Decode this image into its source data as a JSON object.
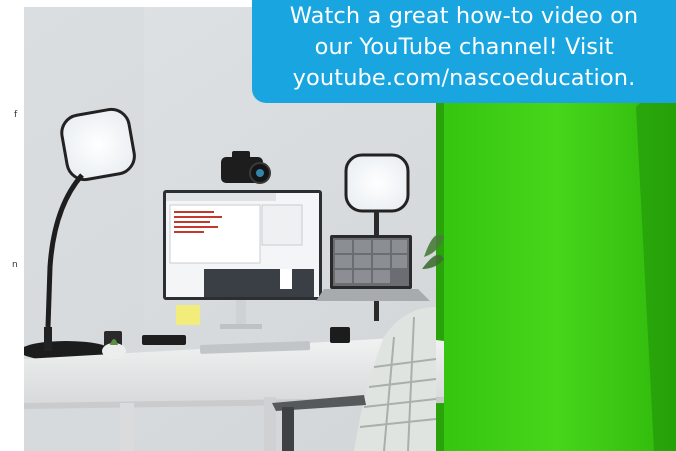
{
  "callout": {
    "line1": "Watch a great how-to video on",
    "line2": "our YouTube channel! Visit",
    "line3": "youtube.com/nascoeducation."
  },
  "photo": {
    "subject": "Desk workstation with ring lights, camera, monitor, laptop and green screen"
  },
  "margin_fragments": {
    "top": "f",
    "mid": "n"
  },
  "colors": {
    "callout_bg": "#19a6e0",
    "green_screen": "#3ccd12",
    "wall": "#e4e6e8"
  }
}
